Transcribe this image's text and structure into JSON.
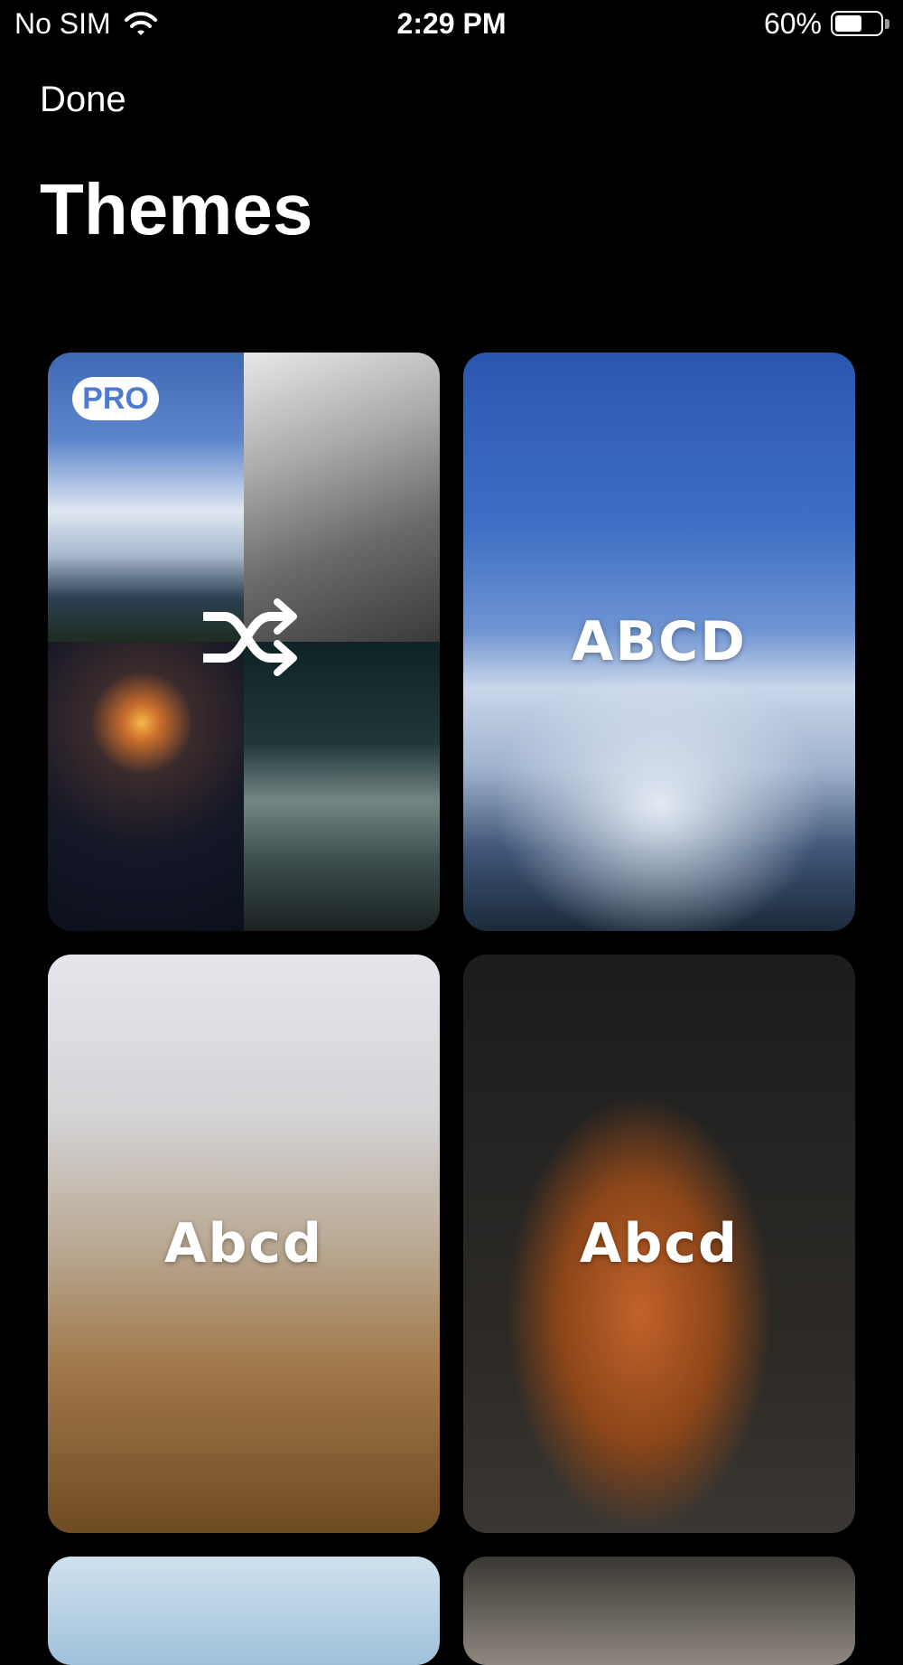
{
  "status_bar": {
    "carrier": "No SIM",
    "time": "2:29 PM",
    "battery": "60%",
    "battery_level": 0.6
  },
  "nav": {
    "done_label": "Done"
  },
  "page": {
    "title": "Themes"
  },
  "themes": [
    {
      "badge": "PRO",
      "icon": "shuffle-icon",
      "label": ""
    },
    {
      "label": "ABCD"
    },
    {
      "label": "Abcd"
    },
    {
      "label": "Abcd"
    }
  ]
}
